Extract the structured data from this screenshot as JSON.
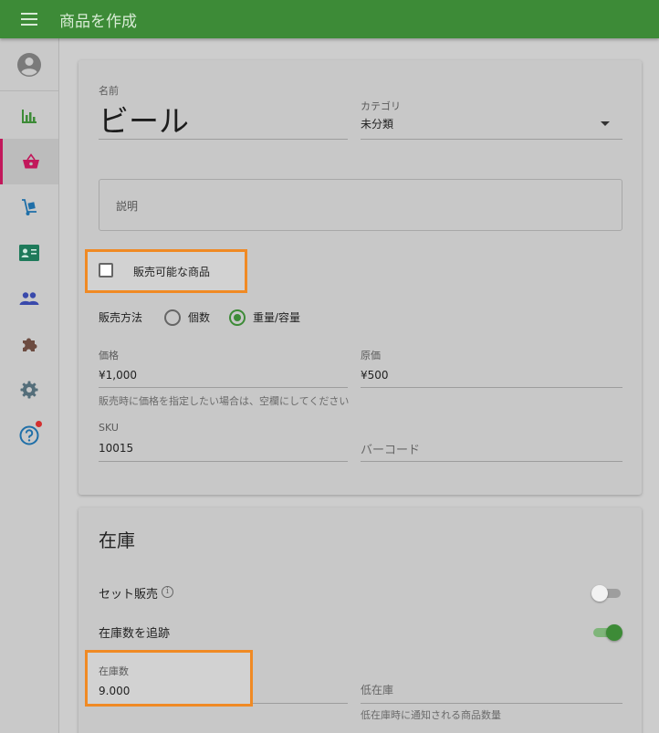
{
  "appbar": {
    "title": "商品を作成",
    "menu_icon": "hamburger-menu-icon"
  },
  "sidebar": {
    "items": [
      {
        "name": "account",
        "icon": "account-circle-icon"
      },
      {
        "name": "reports",
        "icon": "bar-chart-icon"
      },
      {
        "name": "products",
        "icon": "basket-icon",
        "active": true
      },
      {
        "name": "inventory",
        "icon": "hand-truck-icon"
      },
      {
        "name": "customers",
        "icon": "contact-card-icon"
      },
      {
        "name": "employees",
        "icon": "people-icon"
      },
      {
        "name": "addons",
        "icon": "puzzle-icon"
      },
      {
        "name": "settings",
        "icon": "gear-icon"
      },
      {
        "name": "help",
        "icon": "help-circle-icon",
        "badge_color": "#d32f2f"
      }
    ]
  },
  "product": {
    "name_label": "名前",
    "name_value": "ビール",
    "category_label": "カテゴリ",
    "category_value": "未分類",
    "description_placeholder": "説明",
    "sellable_label": "販売可能な商品",
    "sellable_checked": false,
    "sold_by_label": "販売方法",
    "sold_by_options": [
      "個数",
      "重量/容量"
    ],
    "sold_by_selected": "重量/容量",
    "price_label": "価格",
    "price_value": "¥1,000",
    "price_hint": "販売時に価格を指定したい場合は、空欄にしてください",
    "cost_label": "原価",
    "cost_value": "¥500",
    "sku_label": "SKU",
    "sku_value": "10015",
    "barcode_placeholder": "バーコード"
  },
  "inventory": {
    "title": "在庫",
    "composite_label": "セット販売",
    "composite_on": false,
    "track_stock_label": "在庫数を追跡",
    "track_stock_on": true,
    "in_stock_label": "在庫数",
    "in_stock_value": "9.000",
    "low_stock_placeholder": "低在庫",
    "low_stock_hint": "低在庫時に通知される商品数量"
  },
  "colors": {
    "primary": "#3d8b37",
    "accent": "#c2185b",
    "highlight": "#f08a24"
  }
}
